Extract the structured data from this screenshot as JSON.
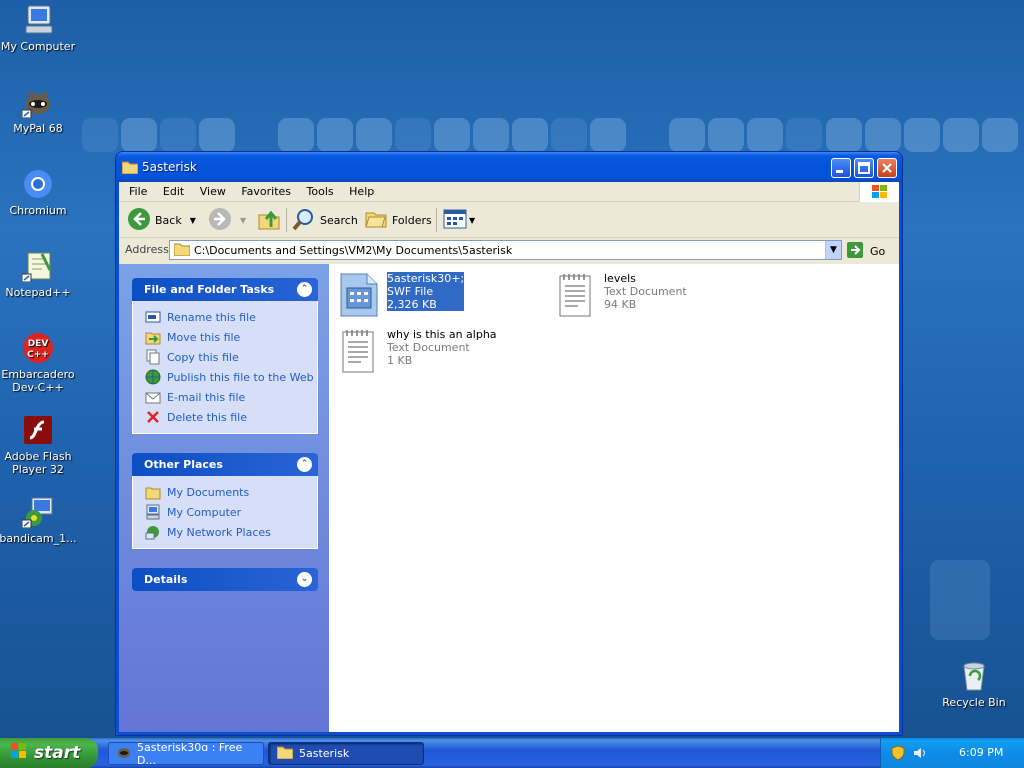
{
  "desktop": {
    "icons": [
      {
        "label": "My Computer"
      },
      {
        "label": "MyPal 68"
      },
      {
        "label": "Chromium"
      },
      {
        "label": "Notepad++"
      },
      {
        "label": "Embarcadero Dev-C++"
      },
      {
        "label": "Adobe Flash Player 32"
      },
      {
        "label": "bandicam_1..."
      },
      {
        "label": "Recycle Bin"
      }
    ]
  },
  "window": {
    "title": "5asterisk",
    "menu": [
      "File",
      "Edit",
      "View",
      "Favorites",
      "Tools",
      "Help"
    ],
    "toolbar": {
      "back_label": "Back",
      "search_label": "Search",
      "folders_label": "Folders"
    },
    "address": {
      "label": "Address",
      "value": "C:\\Documents and Settings\\VM2\\My Documents\\5asterisk",
      "go_label": "Go"
    },
    "task_pane": {
      "file_tasks": {
        "title": "File and Folder Tasks",
        "items": [
          {
            "label": "Rename this file",
            "icon": "rename-icon"
          },
          {
            "label": "Move this file",
            "icon": "move-icon"
          },
          {
            "label": "Copy this file",
            "icon": "copy-icon"
          },
          {
            "label": "Publish this file to the Web",
            "icon": "globe-icon"
          },
          {
            "label": "E-mail this file",
            "icon": "email-icon"
          },
          {
            "label": "Delete this file",
            "icon": "delete-icon"
          }
        ]
      },
      "other_places": {
        "title": "Other Places",
        "items": [
          {
            "label": "My Documents",
            "icon": "folder-icon"
          },
          {
            "label": "My Computer",
            "icon": "computer-icon"
          },
          {
            "label": "My Network Places",
            "icon": "network-icon"
          }
        ]
      },
      "details": {
        "title": "Details"
      }
    },
    "files": [
      {
        "name": "5asterisk30+;",
        "type": "SWF File",
        "size": "2,326 KB",
        "selected": true,
        "icon": "swf-file-icon"
      },
      {
        "name": "levels",
        "type": "Text Document",
        "size": "94 KB",
        "selected": false,
        "icon": "text-file-icon"
      },
      {
        "name": "why is this an alpha",
        "type": "Text Document",
        "size": "1 KB",
        "selected": false,
        "icon": "text-file-icon"
      }
    ]
  },
  "taskbar": {
    "start_label": "start",
    "tasks": [
      {
        "label": "5asterisk30ɑ : Free D...",
        "active": false
      },
      {
        "label": "5asterisk",
        "active": true
      }
    ],
    "clock": "6:09 PM"
  },
  "colors": {
    "desktop": "#1f62ad",
    "title_blue": "#0552dc",
    "task_link": "#215dc6",
    "selection": "#316ac5",
    "start_green": "#34983a"
  }
}
